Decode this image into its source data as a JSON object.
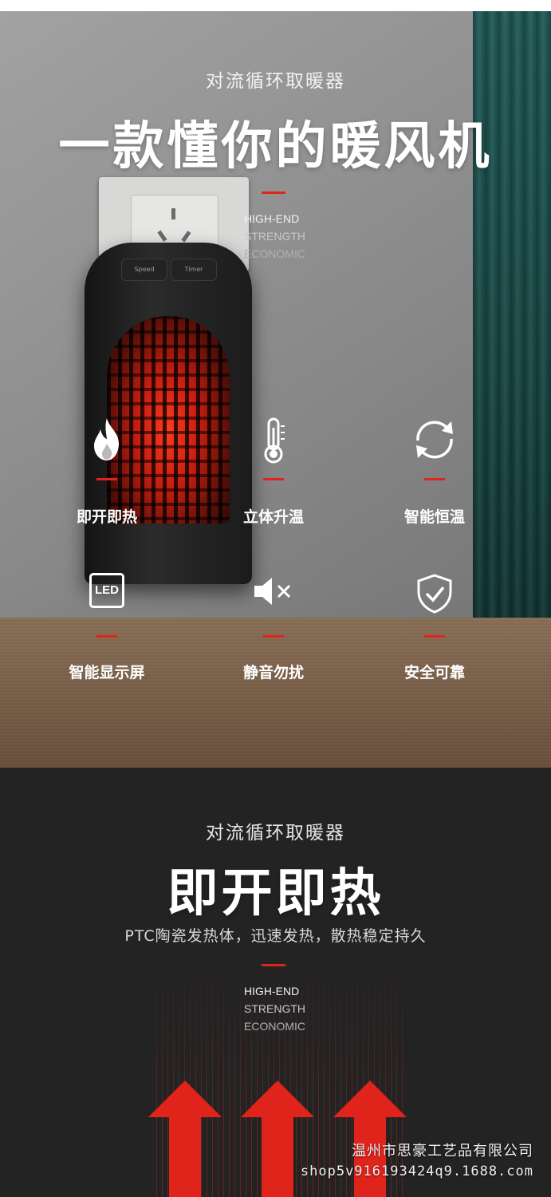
{
  "section1": {
    "subtitle": "对流循环取暖器",
    "title": "一款懂你的暖风机",
    "english": [
      "HIGH-END",
      "STRENGTH",
      "ECONOMIC"
    ],
    "heater_buttons": [
      "Speed",
      "Timer"
    ],
    "features": [
      {
        "icon": "flame-icon",
        "label": "即开即热"
      },
      {
        "icon": "thermometer-icon",
        "label": "立体升温"
      },
      {
        "icon": "cycle-arrows-icon",
        "label": "智能恒温"
      },
      {
        "icon": "led-display-icon",
        "icon_text": "LED",
        "label": "智能显示屏"
      },
      {
        "icon": "mute-speaker-icon",
        "label": "静音勿扰"
      },
      {
        "icon": "shield-check-icon",
        "label": "安全可靠"
      }
    ]
  },
  "section2": {
    "subtitle": "对流循环取暖器",
    "title": "即开即热",
    "description": "PTC陶瓷发热体，迅速发热，散热稳定持久",
    "english": [
      "HIGH-END",
      "STRENGTH",
      "ECONOMIC"
    ]
  },
  "watermark": {
    "company": "温州市思豪工艺品有限公司",
    "shop": "shop5v916193424q9.1688.com"
  },
  "colors": {
    "accent": "#e0241b",
    "dark_bg": "#232323"
  }
}
